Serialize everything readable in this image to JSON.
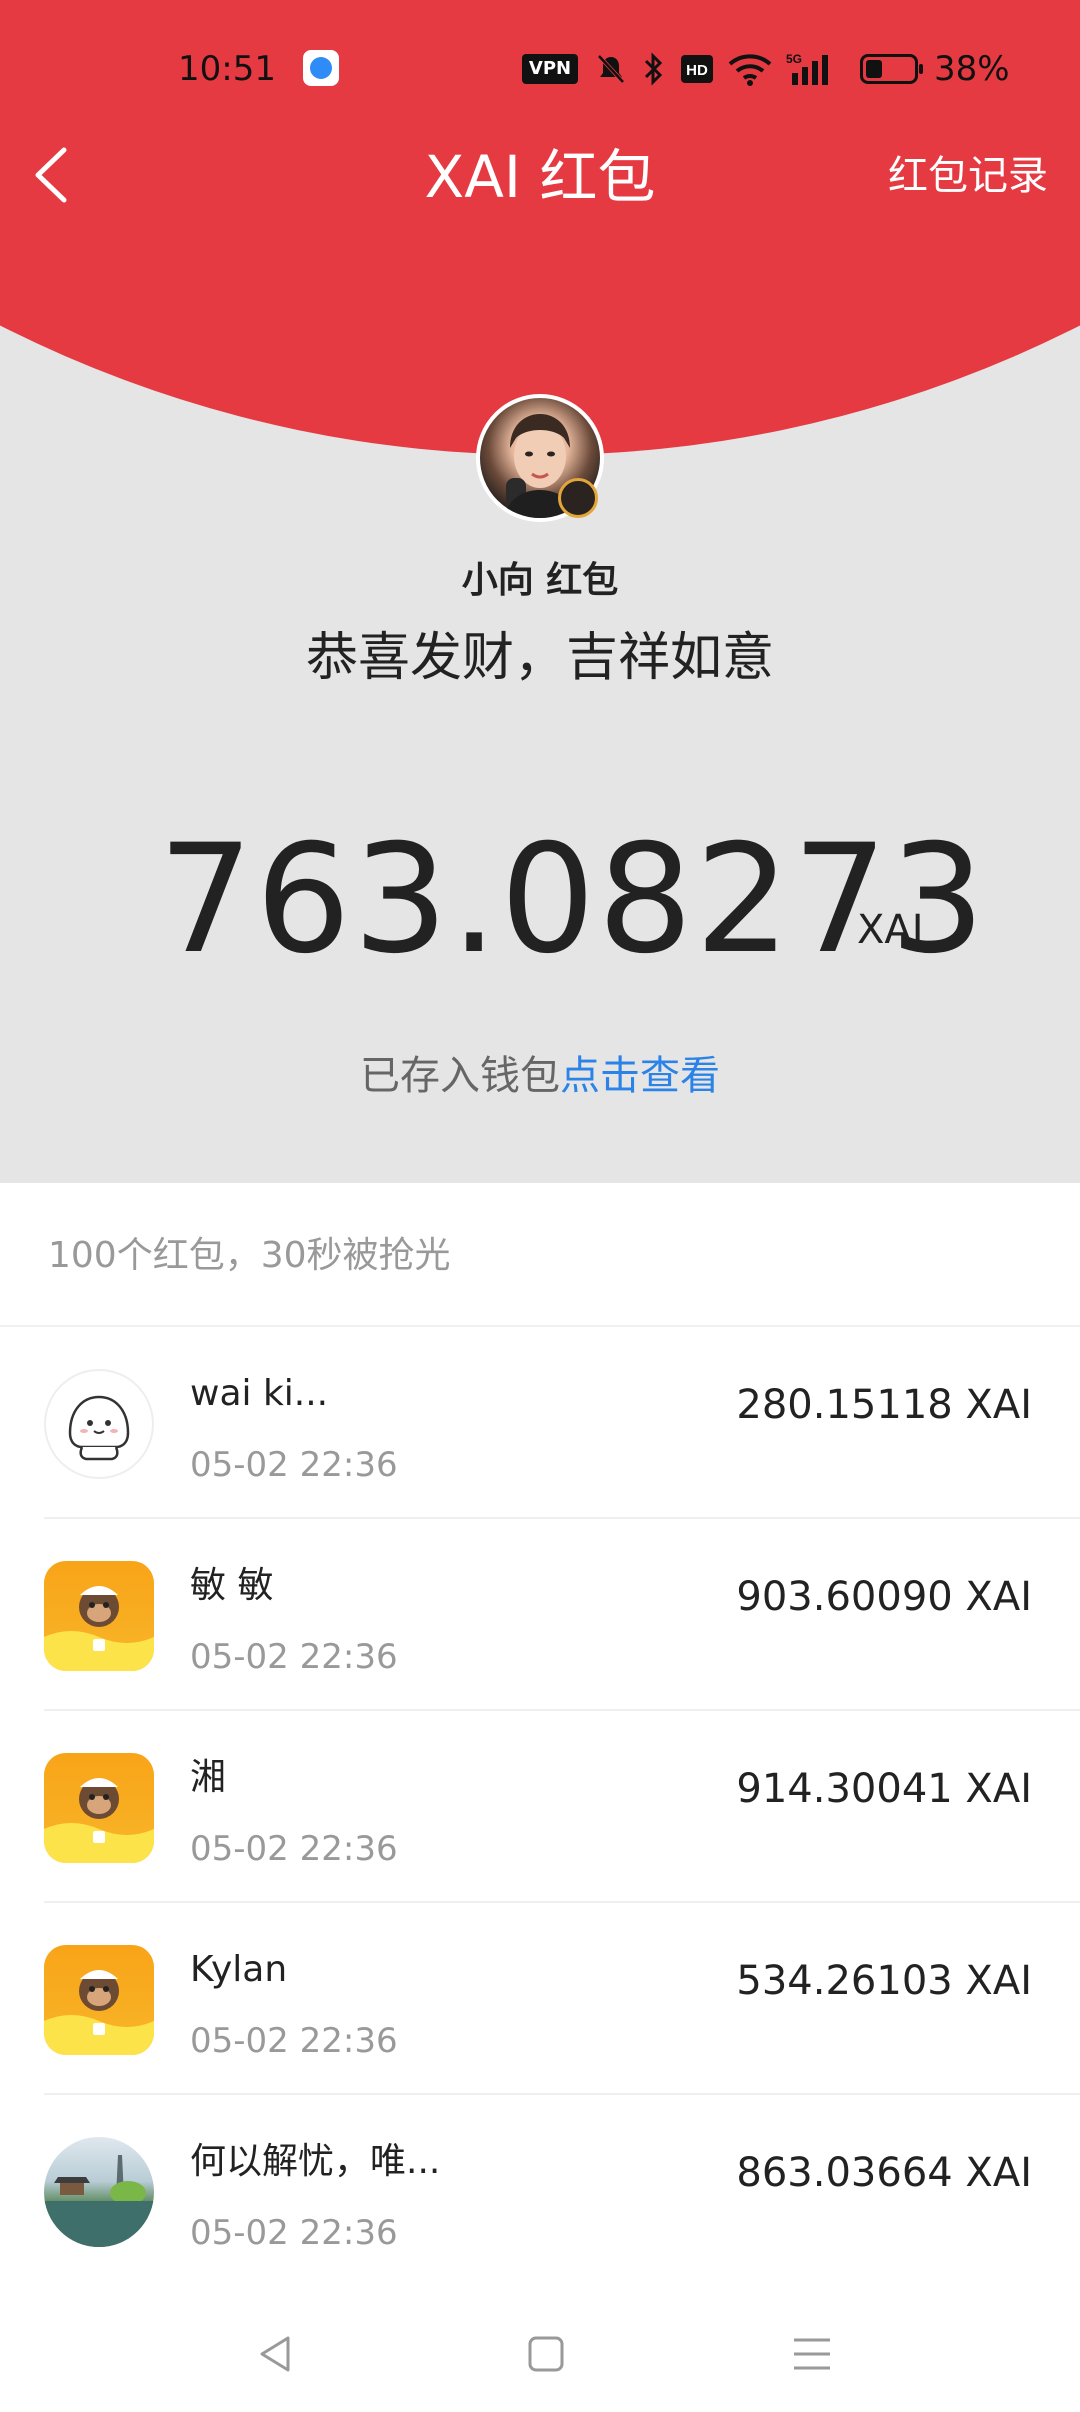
{
  "status_bar": {
    "time": "10:51",
    "vpn": "VPN",
    "battery_percent": "38%",
    "battery_level": 0.38,
    "icons": [
      "app-icon",
      "vpn-icon",
      "mute-icon",
      "bluetooth-icon",
      "hd-icon",
      "wifi-icon",
      "signal-5g-icon",
      "battery-icon"
    ]
  },
  "header": {
    "back_icon": "chevron-left-icon",
    "title": "XAI 红包",
    "records_link": "红包记录"
  },
  "sender": {
    "name": "小向 红包",
    "greeting": "恭喜发财，吉祥如意"
  },
  "received": {
    "amount": "763.08273",
    "unit": "XAI",
    "wallet_text": "已存入钱包",
    "wallet_link": "点击查看"
  },
  "summary": "100个红包，30秒被抢光",
  "recipients": [
    {
      "name": "wai ki...",
      "time": "05-02 22:36",
      "amount": "280.15118 XAI",
      "avatar": "ghost-avatar"
    },
    {
      "name": "敏 敏",
      "time": "05-02 22:36",
      "amount": "903.60090 XAI",
      "avatar": "monkey-avatar"
    },
    {
      "name": "湘",
      "time": "05-02 22:36",
      "amount": "914.30041 XAI",
      "avatar": "monkey-avatar"
    },
    {
      "name": "Kylan",
      "time": "05-02 22:36",
      "amount": "534.26103 XAI",
      "avatar": "monkey-avatar"
    },
    {
      "name": "何以解忧，唯...",
      "time": "05-02 22:36",
      "amount": "863.03664 XAI",
      "avatar": "lake-avatar"
    }
  ],
  "nav_bar": [
    "back-triangle-icon",
    "home-square-icon",
    "menu-lines-icon"
  ],
  "colors": {
    "header_red": "#e63a42",
    "background_gray": "#e5e5e5",
    "link_blue": "#2b83e8",
    "monkey_orange": "#f9a418"
  }
}
